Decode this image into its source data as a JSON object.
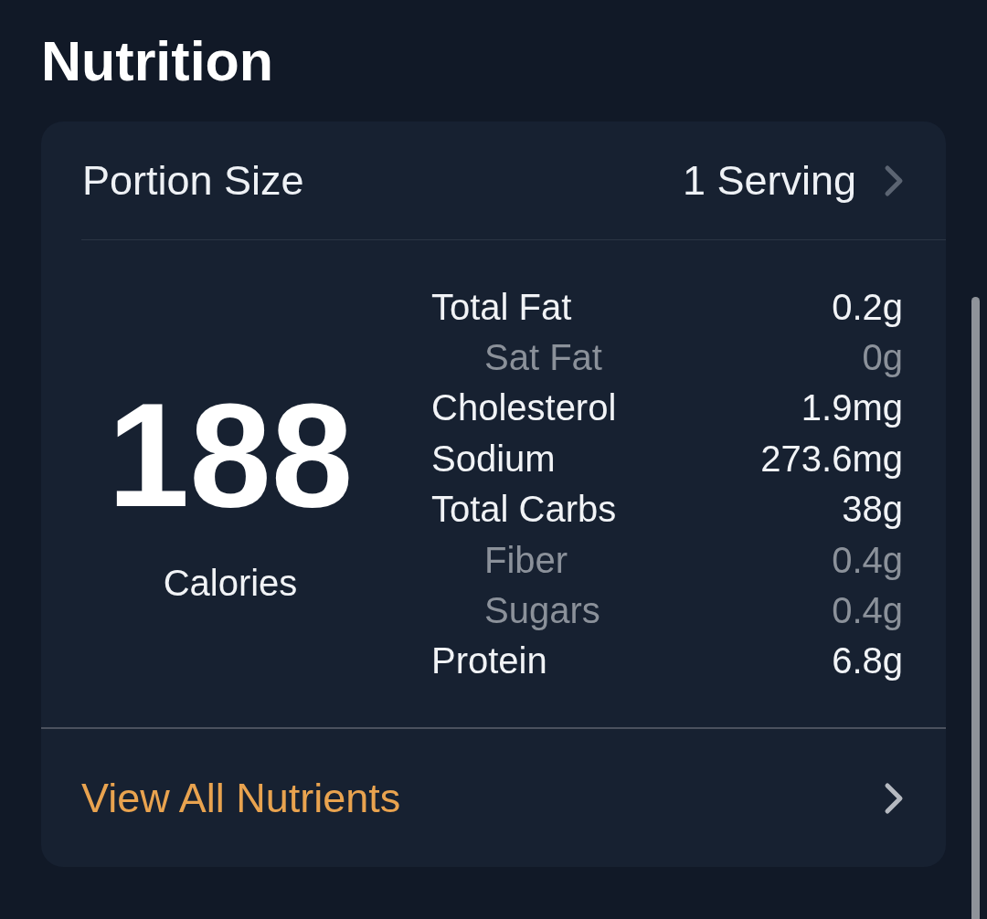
{
  "title": "Nutrition",
  "portion": {
    "label": "Portion Size",
    "value": "1 Serving"
  },
  "calories": {
    "value": "188",
    "label": "Calories"
  },
  "nutrients": [
    {
      "name": "Total Fat",
      "amount": "0.2g",
      "kind": "main"
    },
    {
      "name": "Sat Fat",
      "amount": "0g",
      "kind": "sub"
    },
    {
      "name": "Cholesterol",
      "amount": "1.9mg",
      "kind": "main"
    },
    {
      "name": "Sodium",
      "amount": "273.6mg",
      "kind": "main"
    },
    {
      "name": "Total Carbs",
      "amount": "38g",
      "kind": "main"
    },
    {
      "name": "Fiber",
      "amount": "0.4g",
      "kind": "sub"
    },
    {
      "name": "Sugars",
      "amount": "0.4g",
      "kind": "sub"
    },
    {
      "name": "Protein",
      "amount": "6.8g",
      "kind": "main"
    }
  ],
  "view_all": {
    "label": "View All Nutrients"
  }
}
